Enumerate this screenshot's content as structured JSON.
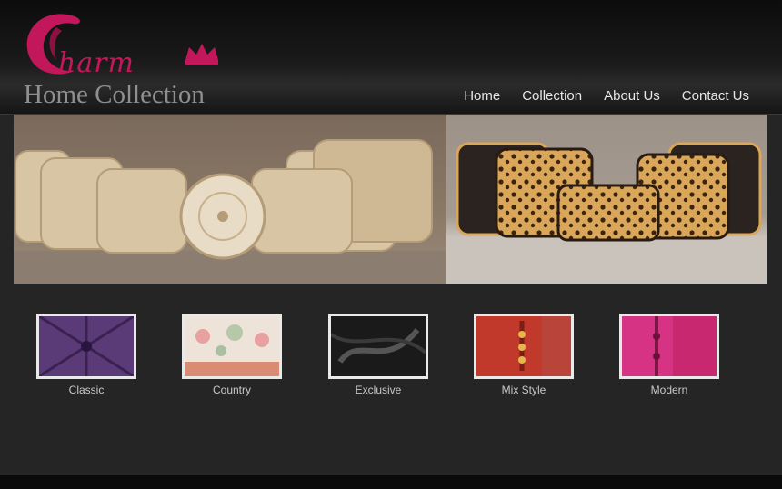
{
  "brand": {
    "script": "harm",
    "subtitle": "Home Collection",
    "accent": "#c2185b"
  },
  "nav": {
    "items": [
      {
        "label": "Home"
      },
      {
        "label": "Collection"
      },
      {
        "label": "About Us"
      },
      {
        "label": "Contact Us"
      }
    ]
  },
  "banner": {
    "left_theme": "gold-lace-cushions",
    "right_theme": "leopard-print-cushions"
  },
  "categories": [
    {
      "label": "Classic",
      "swatch": "#5b3a78"
    },
    {
      "label": "Country",
      "swatch": "#e7c9b5"
    },
    {
      "label": "Exclusive",
      "swatch": "#1a1a1a"
    },
    {
      "label": "Mix Style",
      "swatch": "#c0392b"
    },
    {
      "label": "Modern",
      "swatch": "#d63384"
    }
  ]
}
